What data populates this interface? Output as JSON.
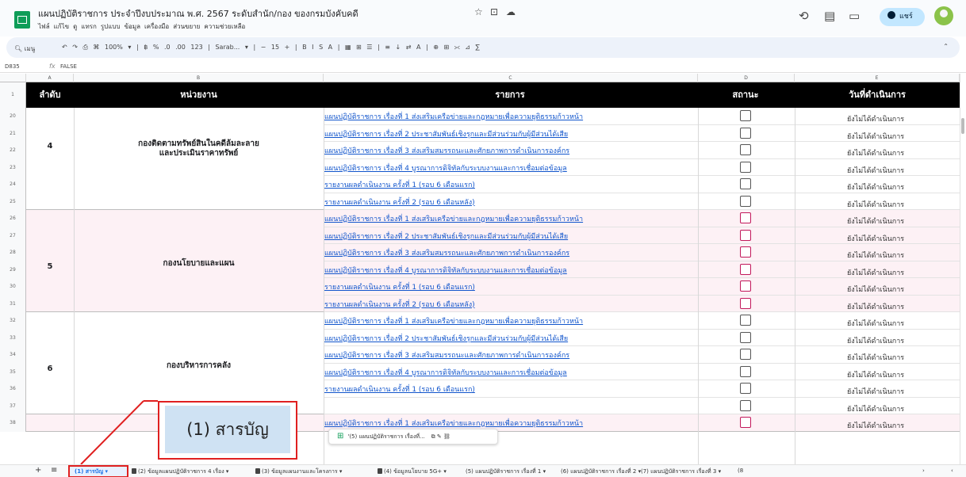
{
  "doc": {
    "title": "แผนปฏิบัติราชการ ประจำปีงบประมาณ พ.ศ. 2567 ระดับสำนัก/กอง ของกรมบังคับคดี",
    "menus": [
      "ไฟล์",
      "แก้ไข",
      "ดู",
      "แทรก",
      "รูปแบบ",
      "ข้อมูล",
      "เครื่องมือ",
      "ส่วนขยาย",
      "ความช่วยเหลือ"
    ],
    "share_label": "แชร์"
  },
  "toolbar": {
    "search": "เมนู",
    "zoom": "100%",
    "font": "Sarab...",
    "font_size": "15",
    "items": "↶ ↷ ⎙ ⌘ 100% ▾ | ฿ % .0 .00 123 | Sarab... ▾ | − 15 + | B I S A | ▦ ⊞ ☰ | ≡ ↓ ⇄ A | ⊕ ⊞ ⪥ ⊿ ∑"
  },
  "formula": {
    "cell": "D835",
    "value": "FALSE"
  },
  "columns": [
    "A",
    "B",
    "C",
    "D",
    "E"
  ],
  "header": {
    "seq": "ลำดับ",
    "unit": "หน่วยงาน",
    "item": "รายการ",
    "status": "สถานะ",
    "date": "วันที่ดำเนินการ"
  },
  "item_links": [
    "แผนปฏิบัติราชการ เรื่องที่ 1 ส่งเสริมเครือข่ายและกฎหมายเพื่อความยุติธรรมก้าวหน้า",
    "แผนปฏิบัติราชการ เรื่องที่ 2 ประชาสัมพันธ์เชิงรุกและมีส่วนร่วมกับผู้มีส่วนได้เสีย",
    "แผนปฏิบัติราชการ เรื่องที่ 3 ส่งเสริมสมรรถนะและศักยภาพการดำเนินการองค์กร",
    "แผนปฏิบัติราชการ เรื่องที่ 4 บูรณาการดิจิทัลกับระบบงานและการเชื่อมต่อข้อมูล",
    "รายงานผลดำเนินงาน ครั้งที่ 1 (รอบ 6 เดือนแรก)",
    "รายงานผลดำเนินงาน ครั้งที่ 2 (รอบ 6 เดือนหลัง)"
  ],
  "status_text": "ยังไม่ได้ดำเนินการ",
  "groups": [
    {
      "num": "4",
      "unit": "กองติดตามทรัพย์สินในคดีล้มละลาย และประเมินราคาทรัพย์",
      "rows": [
        "20",
        "21",
        "22",
        "23",
        "24",
        "25"
      ]
    },
    {
      "num": "5",
      "unit": "กองนโยบายและแผน",
      "rows": [
        "26",
        "27",
        "28",
        "29",
        "30",
        "31"
      ]
    },
    {
      "num": "6",
      "unit": "กองบริหารการคลัง",
      "rows": [
        "32",
        "33",
        "34",
        "35",
        "36",
        "37"
      ]
    }
  ],
  "row38": "38",
  "callout": "(1) สารบัญ",
  "chip": "'(5) แผนปฏิบัติราชการ เรื่องที่...",
  "tabs": [
    {
      "label": "(1) สารบัญ",
      "locked": false
    },
    {
      "label": "(2) ข้อมูลแผนปฏิบัติราชการ 4 เรื่อง",
      "locked": true
    },
    {
      "label": "(3) ข้อมูลแผนงานและโครงการ",
      "locked": true
    },
    {
      "label": "(4) ข้อมูลนโยบาย 5G+",
      "locked": true
    },
    {
      "label": "(5) แผนปฏิบัติราชการ เรื่องที่ 1",
      "locked": false
    },
    {
      "label": "(6) แผนปฏิบัติราชการ เรื่องที่ 2",
      "locked": false
    },
    {
      "label": "(7) แผนปฏิบัติราชการ เรื่องที่ 3",
      "locked": false
    },
    {
      "label": "(8",
      "locked": false
    }
  ]
}
